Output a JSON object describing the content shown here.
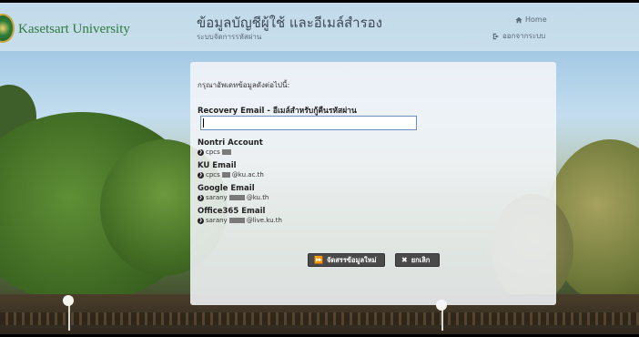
{
  "header": {
    "brand": "Kasetsart University",
    "title": "ข้อมูลบัญชีผู้ใช้ และอีเมล์สำรอง",
    "subtitle": "ระบบจัดการรหัสผ่าน",
    "nav": {
      "home": "Home",
      "logout": "ออกจากระบบ"
    }
  },
  "form": {
    "instruction": "กรุณาอัพเดทข้อมูลดังต่อไปนี้:",
    "recovery_label": "Recovery Email - อีเมล์สำหรับกู้คืนรหัสผ่าน",
    "recovery_value": "",
    "accounts": [
      {
        "title": "Nontri Account",
        "prefix": "cpcs",
        "suffix": ""
      },
      {
        "title": "KU Email",
        "prefix": "cpcs",
        "suffix": "@ku.ac.th"
      },
      {
        "title": "Google Email",
        "prefix": "sarany",
        "suffix": "@ku.th"
      },
      {
        "title": "Office365 Email",
        "prefix": "sarany",
        "suffix": "@live.ku.th"
      }
    ],
    "buttons": {
      "save": "จัดสรรข้อมูลใหม่",
      "cancel": "ยกเลิก"
    }
  },
  "icons": {
    "home": "home-icon",
    "logout": "logout-icon",
    "save": "fast-forward-icon",
    "cancel": "close-icon",
    "bullet": "chevron-circle-right-icon"
  },
  "colors": {
    "brand": "#2f7a3e",
    "button": "#4a4a4a",
    "input_border": "#6a8fc0"
  }
}
